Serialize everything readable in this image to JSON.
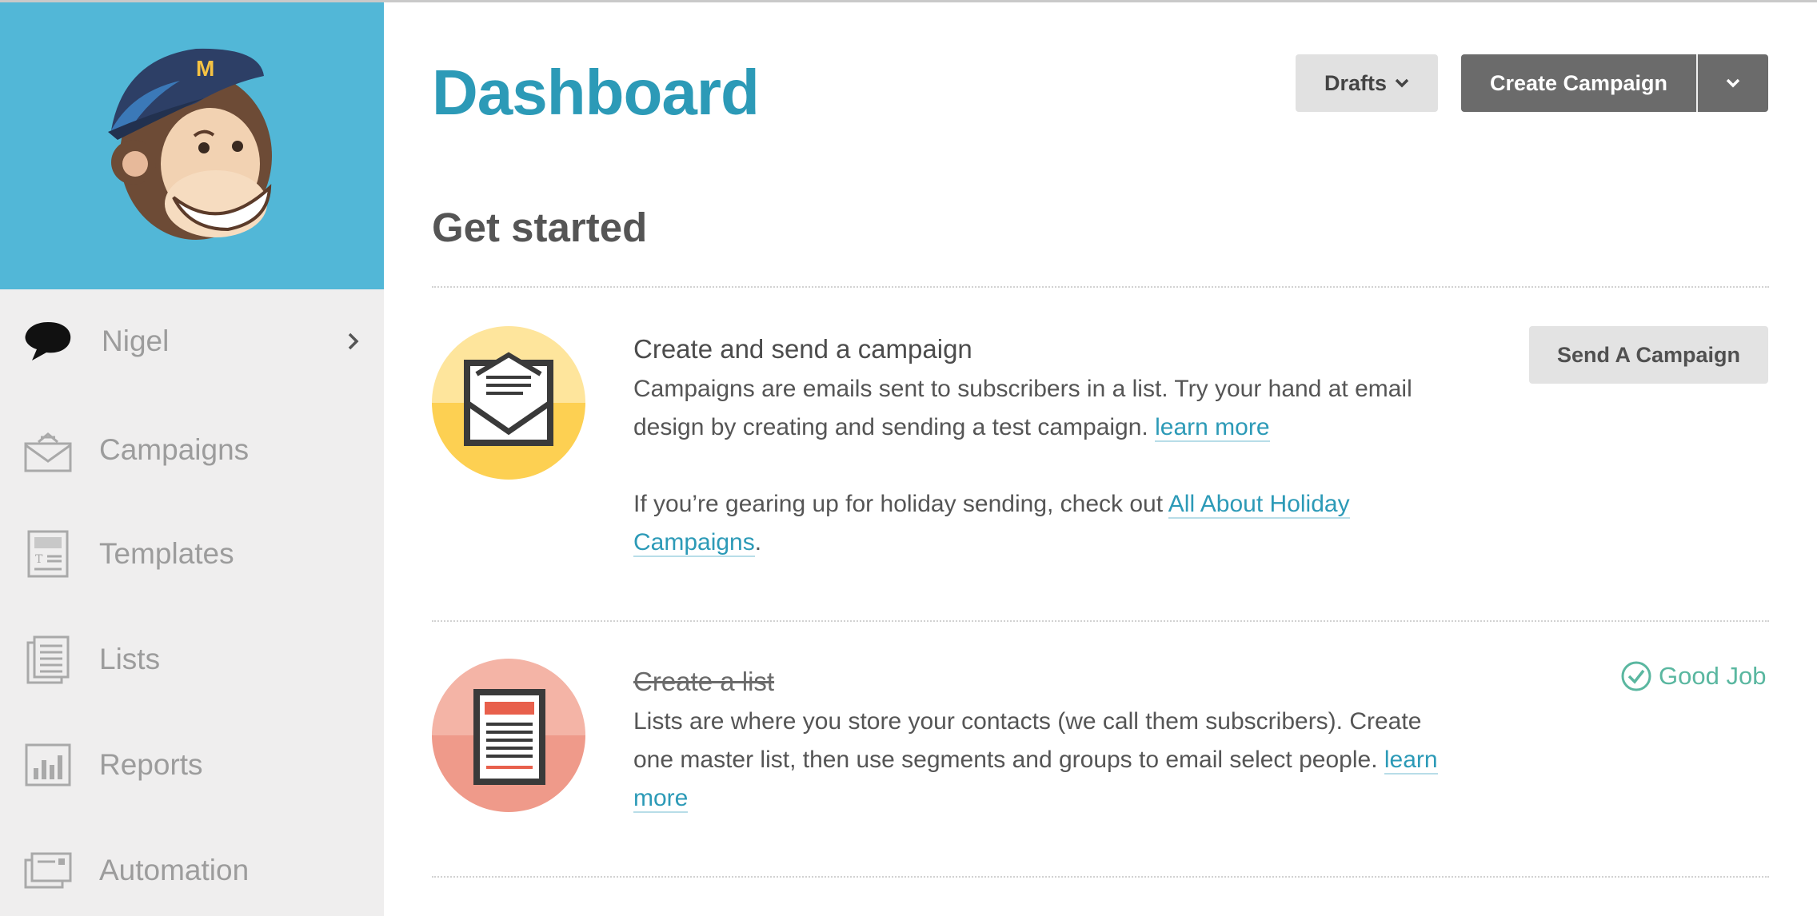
{
  "header": {
    "title": "Dashboard",
    "drafts_label": "Drafts",
    "create_campaign_label": "Create Campaign"
  },
  "sidebar": {
    "user": {
      "name": "Nigel"
    },
    "items": [
      {
        "label": "Campaigns",
        "icon": "campaigns-icon"
      },
      {
        "label": "Templates",
        "icon": "templates-icon"
      },
      {
        "label": "Lists",
        "icon": "lists-icon"
      },
      {
        "label": "Reports",
        "icon": "reports-icon"
      },
      {
        "label": "Automation",
        "icon": "automation-icon"
      }
    ]
  },
  "main": {
    "section_title": "Get started",
    "steps": [
      {
        "title": "Create and send a campaign",
        "text_1": "Campaigns are emails sent to subscribers in a list. Try your hand at email design by creating and sending a test campaign.",
        "link_1": "learn more",
        "text_2": "If you’re gearing up for holiday sending, check out",
        "link_2": "All About Holiday Campaigns",
        "text_2_end": ".",
        "button_label": "Send A Campaign",
        "icon": "envelope-icon"
      },
      {
        "title": "Create a list",
        "completed": true,
        "text_1": "Lists are where you store your contacts (we call them subscribers). Create one master list, then use segments and groups to email select people.",
        "link_1": "learn more",
        "status_label": "Good Job",
        "icon": "list-document-icon"
      }
    ]
  },
  "colors": {
    "brand_blue": "#2c9ab7",
    "sidebar_header": "#52b7d7",
    "success": "#5ab7a0"
  }
}
